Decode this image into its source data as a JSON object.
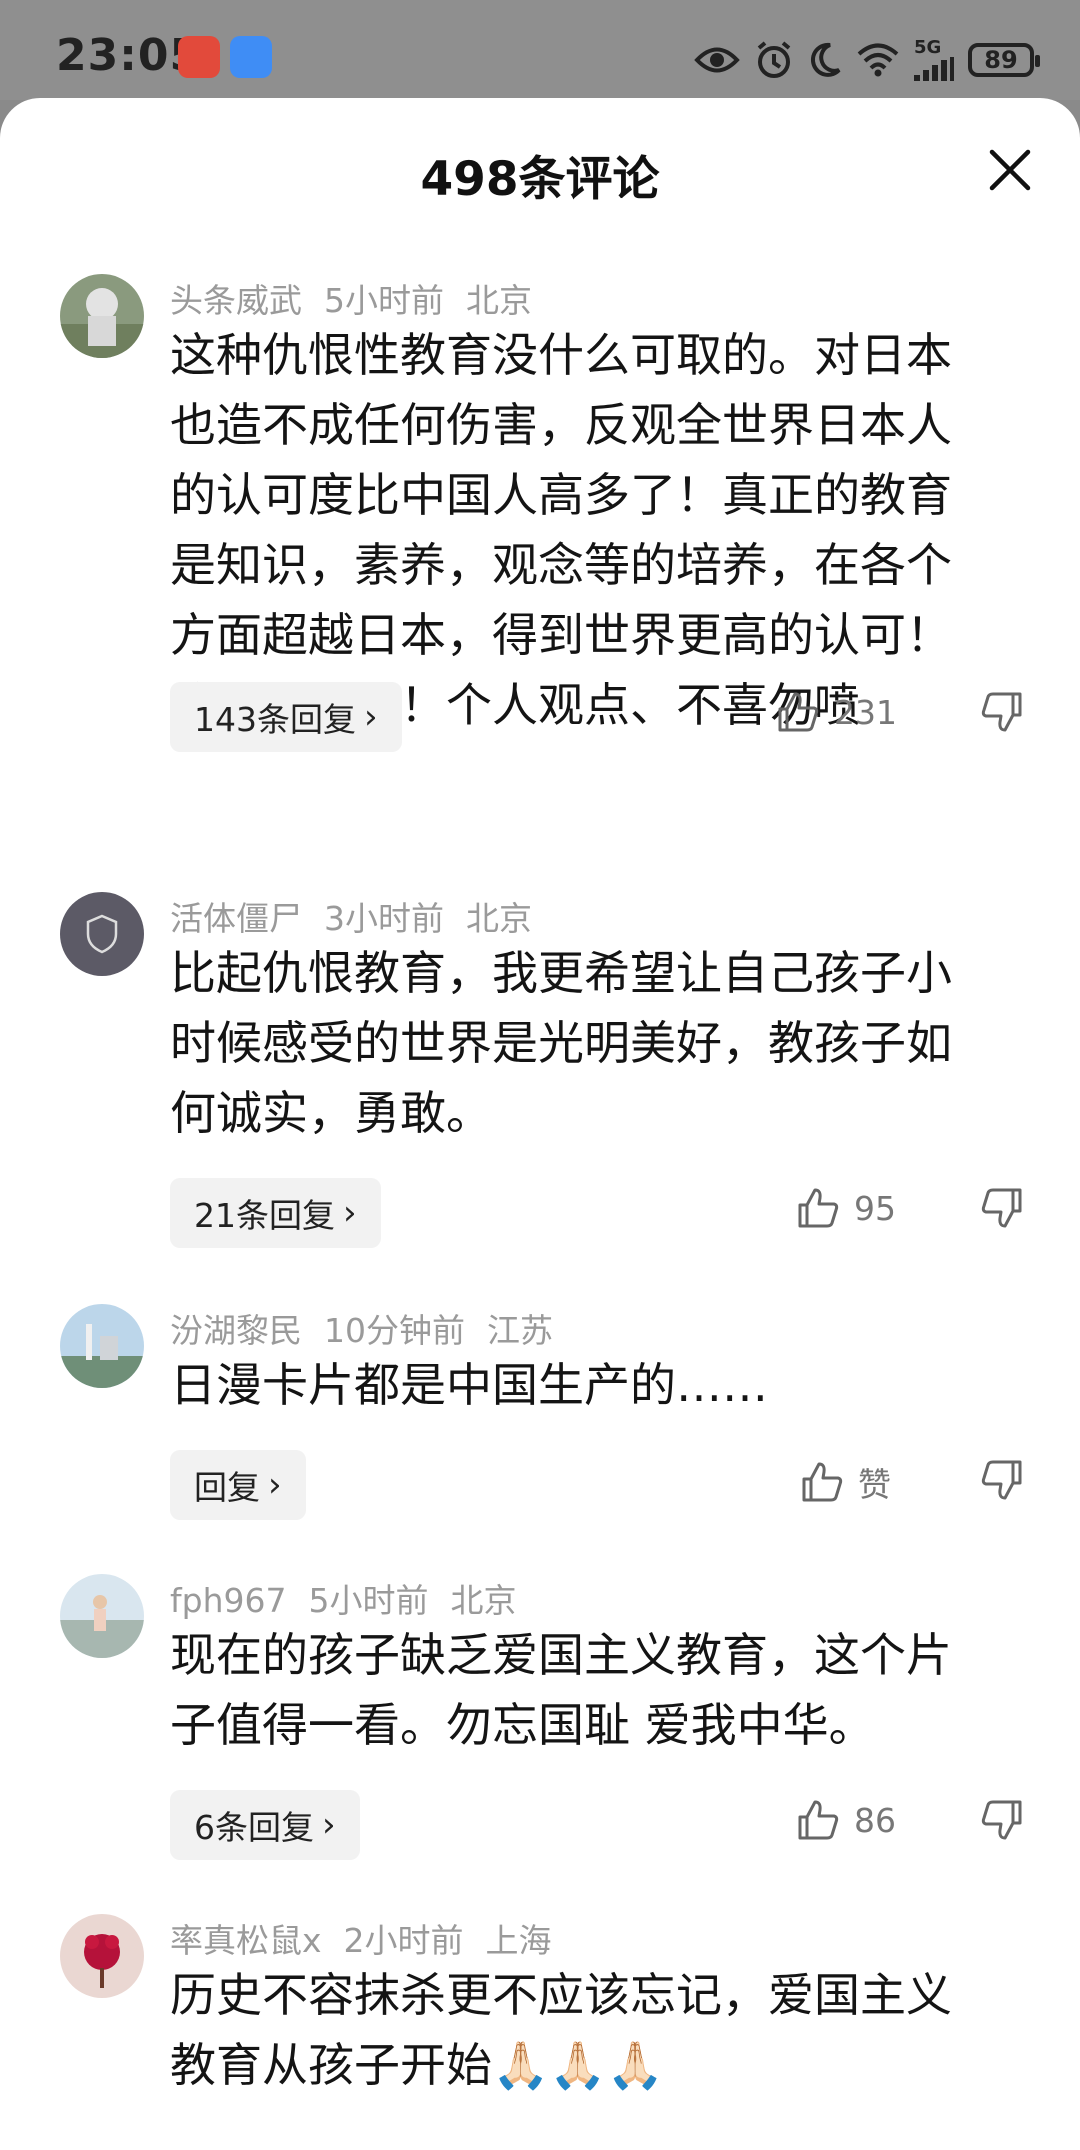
{
  "status_bar": {
    "time": "23:05",
    "battery": "89",
    "network": "5G",
    "icons": [
      "eye-icon",
      "alarm-icon",
      "moon-icon",
      "wifi-icon",
      "signal-icon",
      "battery-icon"
    ]
  },
  "sheet": {
    "title": "498条评论"
  },
  "comments": [
    {
      "user": "头条威武",
      "time": "5小时前",
      "location": "北京",
      "text": "这种仇恨性教育没什么可取的。对日本\n也造不成任何伤害，反观全世界日本人\n的认可度比中国人高多了！真正的教育\n是知识，素养，观念等的培养，在各个\n方面超越日本，得到世界更高的认可！\n这才叫反超！个人观点、不喜勿喷",
      "replies": "143条回复",
      "likes": "231"
    },
    {
      "user": "活体僵尸",
      "time": "3小时前",
      "location": "北京",
      "text": "比起仇恨教育，我更希望让自己孩子小\n时候感受的世界是光明美好，教孩子如\n何诚实，勇敢。",
      "replies": "21条回复",
      "likes": "95"
    },
    {
      "user": "汾湖黎民",
      "time": "10分钟前",
      "location": "江苏",
      "text": "日漫卡片都是中国生产的……",
      "replies": "回复",
      "likes": "赞"
    },
    {
      "user": "fph967",
      "time": "5小时前",
      "location": "北京",
      "text": "现在的孩子缺乏爱国主义教育，这个片\n子值得一看。勿忘国耻 爱我中华。",
      "replies": "6条回复",
      "likes": "86"
    },
    {
      "user": "率真松鼠x",
      "time": "2小时前",
      "location": "上海",
      "text": "历史不容抹杀更不应该忘记，爱国主义\n教育从孩子开始🙏🏻🙏🏻🙏🏻"
    }
  ],
  "colors": {
    "meta": "#9a9a9a",
    "text": "#141414",
    "chip": "#f2f2f2"
  }
}
